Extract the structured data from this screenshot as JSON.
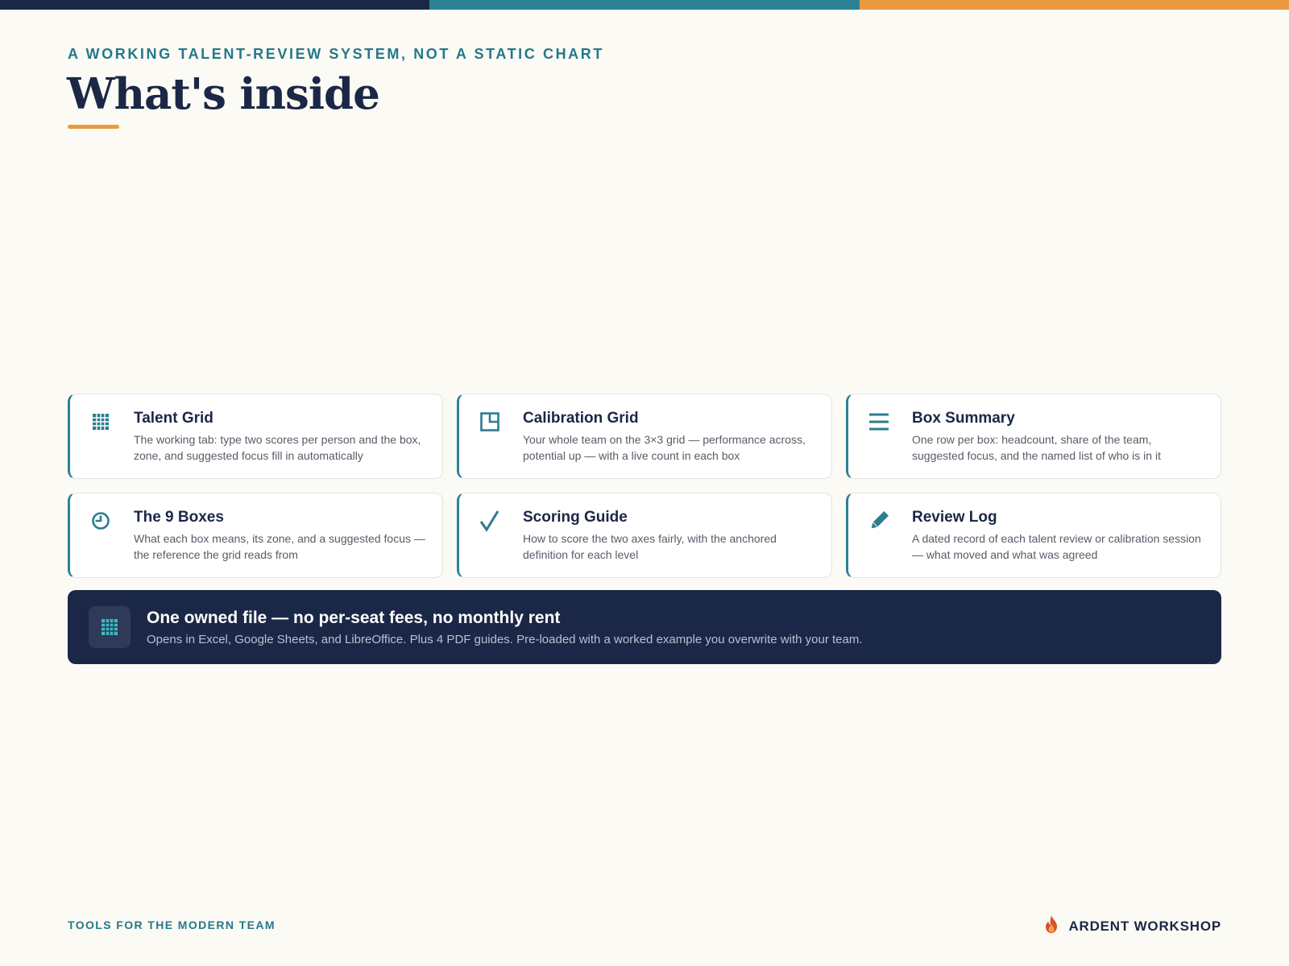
{
  "header": {
    "eyebrow": "A WORKING TALENT-REVIEW SYSTEM, NOT A STATIC CHART",
    "title": "What's inside"
  },
  "cards": [
    {
      "title": "Talent Grid",
      "description": "The working tab: type two scores per person and the box, zone, and suggested focus fill in automatically",
      "icon": "grid-icon"
    },
    {
      "title": "Calibration Grid",
      "description": "Your whole team on the 3×3 grid — performance across, potential up — with a live count in each box",
      "icon": "layout-icon"
    },
    {
      "title": "Box Summary",
      "description": "One row per box: headcount, share of the team, suggested focus, and the named list of who is in it",
      "icon": "list-icon"
    },
    {
      "title": "The 9 Boxes",
      "description": "What each box means, its zone, and a suggested focus — the reference the grid reads from",
      "icon": "clock-icon"
    },
    {
      "title": "Scoring Guide",
      "description": "How to score the two axes fairly, with the anchored definition for each level",
      "icon": "checkmark-icon"
    },
    {
      "title": "Review Log",
      "description": "A dated record of each talent review or calibration session — what moved and what was agreed",
      "icon": "pencil-icon"
    }
  ],
  "banner": {
    "title": "One owned file — no per-seat fees, no monthly rent",
    "subtitle": "Opens in Excel, Google Sheets, and LibreOffice. Plus 4 PDF guides. Pre-loaded with a worked example you overwrite with your team.",
    "icon": "grid-icon"
  },
  "footer": {
    "tagline": "TOOLS FOR THE MODERN TEAM",
    "brand": "ARDENT WORKSHOP",
    "brand_icon": "flame-icon"
  },
  "colors": {
    "navy": "#1b2746",
    "teal": "#2c8294",
    "orange": "#eb9a40",
    "background": "#fbfaf4"
  }
}
